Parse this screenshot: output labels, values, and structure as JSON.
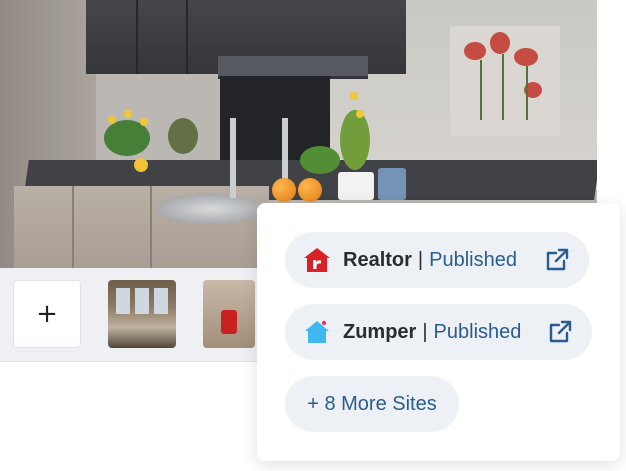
{
  "thumbnails": {
    "add_label": "+",
    "items": [
      {
        "alt": "living-room-photo"
      },
      {
        "alt": "room-with-red-chair-photo"
      }
    ]
  },
  "publish_card": {
    "sites": [
      {
        "name": "Realtor",
        "separator": "|",
        "status": "Published",
        "icon": "realtor-logo-icon",
        "brand_color": "#d92228"
      },
      {
        "name": "Zumper",
        "separator": "|",
        "status": "Published",
        "icon": "zumper-house-icon",
        "brand_color": "#3fb8f0"
      }
    ],
    "more_sites_label": "+ 8 More Sites"
  },
  "colors": {
    "accent": "#2a5d8f",
    "pill_bg": "#edf0f4",
    "text_dark": "#2b2b33"
  }
}
